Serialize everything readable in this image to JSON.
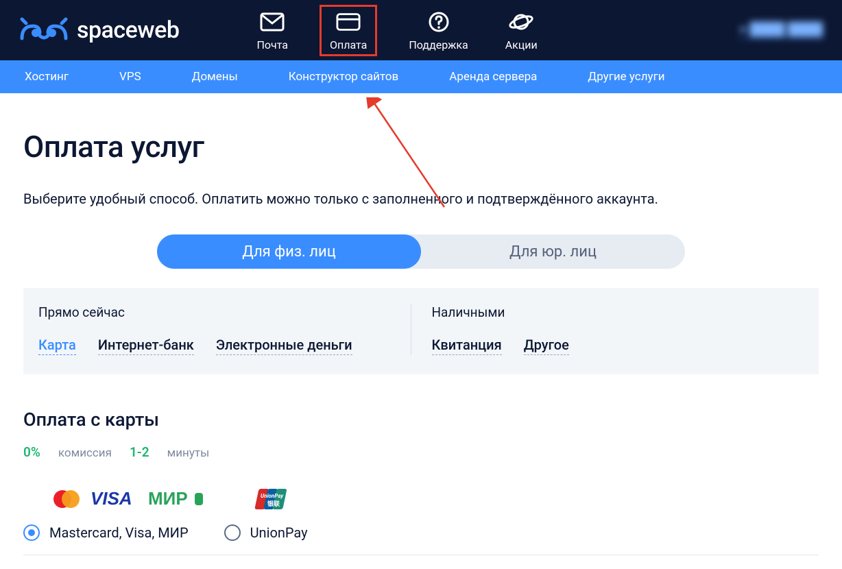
{
  "header": {
    "brand": "spaceweb",
    "nav": [
      {
        "label": "Почта",
        "icon": "mail-icon"
      },
      {
        "label": "Оплата",
        "icon": "card-icon",
        "highlight": true
      },
      {
        "label": "Поддержка",
        "icon": "help-icon"
      },
      {
        "label": "Акции",
        "icon": "planet-icon"
      }
    ],
    "user_placeholder": "● ████ ████"
  },
  "subnav": [
    "Хостинг",
    "VPS",
    "Домены",
    "Конструктор сайтов",
    "Аренда сервера",
    "Другие услуги"
  ],
  "page": {
    "title": "Оплата услуг",
    "intro": "Выберите удобный способ. Оплатить можно только с заполненного и подтверждённого аккаунта.",
    "toggle": {
      "options": [
        "Для физ. лиц",
        "Для юр. лиц"
      ],
      "active": 0
    },
    "categories": {
      "left": {
        "title": "Прямо сейчас",
        "links": [
          "Карта",
          "Интернет-банк",
          "Электронные деньги"
        ],
        "active": 0
      },
      "right": {
        "title": "Наличными",
        "links": [
          "Квитанция",
          "Другое"
        ]
      }
    },
    "card_section": {
      "title": "Оплата с карты",
      "commission_value": "0%",
      "commission_label": "комиссия",
      "time_value": "1-2",
      "time_label": "минуты",
      "radios": [
        {
          "label": "Mastercard, Visa, МИР",
          "checked": true
        },
        {
          "label": "UnionPay",
          "checked": false
        }
      ]
    }
  },
  "colors": {
    "accent": "#3a8dff",
    "dark": "#0c1733",
    "green": "#1db66f",
    "highlight": "#e43b2d"
  }
}
